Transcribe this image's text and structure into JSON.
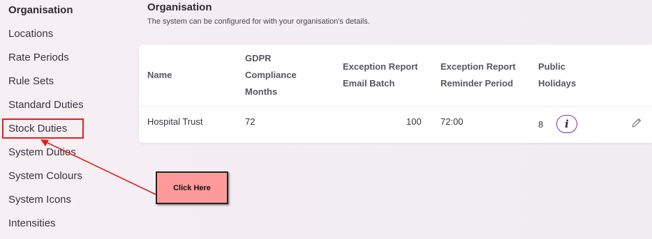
{
  "sidebar": {
    "items": [
      {
        "label": "Organisation",
        "active": true
      },
      {
        "label": "Locations"
      },
      {
        "label": "Rate Periods"
      },
      {
        "label": "Rule Sets"
      },
      {
        "label": "Standard Duties"
      },
      {
        "label": "Stock Duties"
      },
      {
        "label": "System Duties"
      },
      {
        "label": "System Colours"
      },
      {
        "label": "System Icons"
      },
      {
        "label": "Intensities"
      }
    ]
  },
  "header": {
    "title": "Organisation",
    "subtitle": "The system can be configured for with your organisation's details."
  },
  "table": {
    "columns": [
      {
        "lines": [
          "Name"
        ]
      },
      {
        "lines": [
          "GDPR",
          "Compliance",
          "Months"
        ]
      },
      {
        "lines": [
          "Exception Report",
          "Email Batch"
        ]
      },
      {
        "lines": [
          "Exception Report",
          "Reminder Period"
        ]
      },
      {
        "lines": [
          "Public",
          "Holidays"
        ]
      }
    ],
    "rows": [
      {
        "name": "Hospital Trust",
        "gdpr_months": "72",
        "email_batch": "100",
        "reminder_period": "72:00",
        "public_holidays": "8",
        "info_glyph": "i"
      }
    ]
  },
  "annotation": {
    "callout_label": "Click Here",
    "color": "#e0201a"
  },
  "icons": {
    "info": "info-icon",
    "edit": "pencil-icon"
  }
}
